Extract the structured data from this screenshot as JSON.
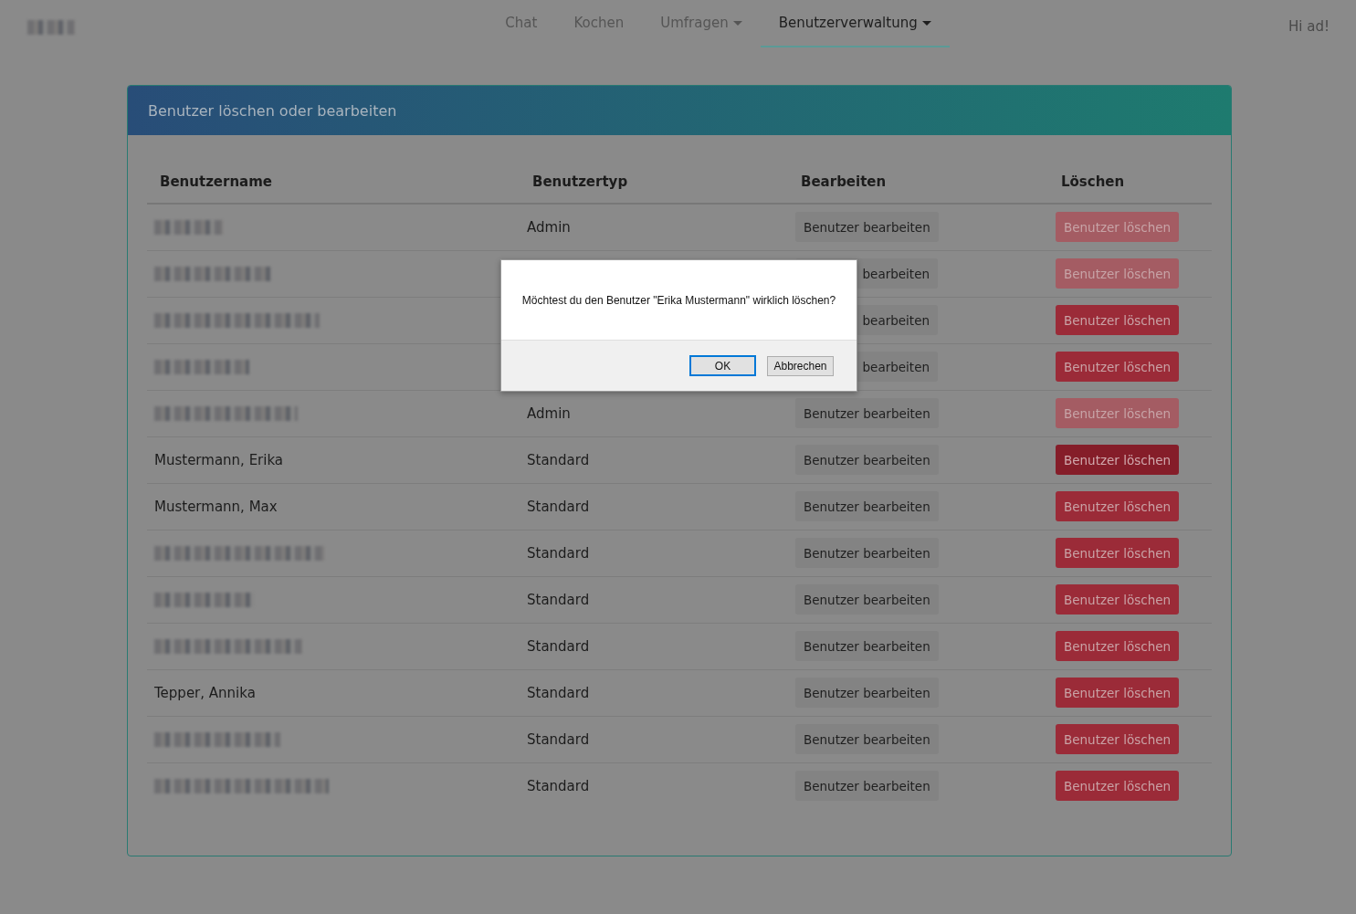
{
  "navbar": {
    "logo": {
      "redacted": true
    },
    "items": [
      {
        "label": "Chat",
        "dropdown": false,
        "selected": false
      },
      {
        "label": "Kochen",
        "dropdown": false,
        "selected": false
      },
      {
        "label": "Umfragen",
        "dropdown": true,
        "selected": false
      },
      {
        "label": "Benutzerverwaltung",
        "dropdown": true,
        "selected": true
      }
    ],
    "greeting": "Hi ad!"
  },
  "card": {
    "title": "Benutzer löschen oder bearbeiten",
    "table": {
      "columns": [
        "Benutzername",
        "Benutzertyp",
        "Bearbeiten",
        "Löschen"
      ],
      "rows": [
        {
          "redacted": true,
          "type": "Admin",
          "edit": "Benutzer bearbeiten",
          "delete": {
            "label": "Benutzer löschen",
            "disabled": true,
            "focused": false
          }
        },
        {
          "redacted": true,
          "edit": "bearbeiten",
          "delete": {
            "label": "Benutzer löschen",
            "disabled": true,
            "focused": false
          }
        },
        {
          "redacted": true,
          "edit": "bearbeiten",
          "delete": {
            "label": "Benutzer löschen",
            "disabled": false,
            "focused": false
          }
        },
        {
          "redacted": true,
          "edit": "bearbeiten",
          "delete": {
            "label": "Benutzer löschen",
            "disabled": false,
            "focused": false
          }
        },
        {
          "redacted": true,
          "type": "Admin",
          "edit": "Benutzer bearbeiten",
          "delete": {
            "label": "Benutzer löschen",
            "disabled": true,
            "focused": false
          }
        },
        {
          "redacted": false,
          "name": "Mustermann, Erika",
          "type": "Standard",
          "edit": "Benutzer bearbeiten",
          "delete": {
            "label": "Benutzer löschen",
            "disabled": false,
            "focused": true
          }
        },
        {
          "redacted": false,
          "name": "Mustermann, Max",
          "type": "Standard",
          "edit": "Benutzer bearbeiten",
          "delete": {
            "label": "Benutzer löschen",
            "disabled": false,
            "focused": false
          }
        },
        {
          "redacted": true,
          "type": "Standard",
          "edit": "Benutzer bearbeiten",
          "delete": {
            "label": "Benutzer löschen",
            "disabled": false,
            "focused": false
          }
        },
        {
          "redacted": true,
          "type": "Standard",
          "edit": "Benutzer bearbeiten",
          "delete": {
            "label": "Benutzer löschen",
            "disabled": false,
            "focused": false
          }
        },
        {
          "redacted": true,
          "type": "Standard",
          "edit": "Benutzer bearbeiten",
          "delete": {
            "label": "Benutzer löschen",
            "disabled": false,
            "focused": false
          }
        },
        {
          "redacted": false,
          "name": "Tepper, Annika",
          "type": "Standard",
          "edit": "Benutzer bearbeiten",
          "delete": {
            "label": "Benutzer löschen",
            "disabled": false,
            "focused": false
          }
        },
        {
          "redacted": true,
          "type": "Standard",
          "edit": "Benutzer bearbeiten",
          "delete": {
            "label": "Benutzer löschen",
            "disabled": false,
            "focused": false
          }
        },
        {
          "redacted": true,
          "type": "Standard",
          "edit": "Benutzer bearbeiten",
          "delete": {
            "label": "Benutzer löschen",
            "disabled": false,
            "focused": false
          }
        }
      ]
    }
  },
  "dialog": {
    "message": "Möchtest du den Benutzer \"Erika Mustermann\" wirklich löschen?",
    "buttons": [
      {
        "label": "OK",
        "selected": true
      },
      {
        "label": "Abbrechen",
        "selected": false
      }
    ]
  }
}
